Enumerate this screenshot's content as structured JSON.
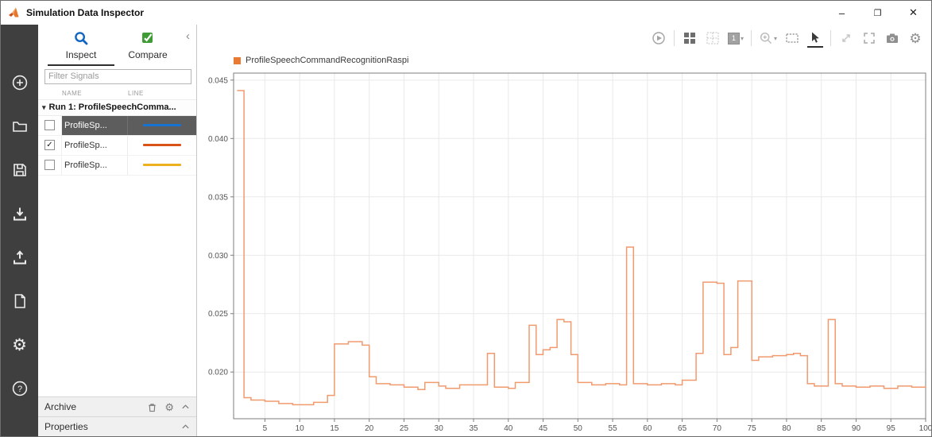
{
  "window": {
    "title": "Simulation Data Inspector",
    "controls": {
      "minimize": "–",
      "maximize": "❐",
      "close": "✕"
    }
  },
  "icons": {
    "checkmark": "✓",
    "caret_down": "▾",
    "collapse_sidebar": "‹",
    "gear": "⚙",
    "help": "?"
  },
  "left_rail": {
    "icons": [
      "add-icon",
      "open-folder-icon",
      "save-icon",
      "import-icon",
      "export-icon",
      "new-report-icon",
      "preferences-gear-icon",
      "help-icon"
    ]
  },
  "sidebar": {
    "tabs": [
      {
        "label": "Inspect",
        "active": true
      },
      {
        "label": "Compare",
        "active": false
      }
    ],
    "filter_placeholder": "Filter Signals",
    "columns": {
      "name": "NAME",
      "line": "LINE"
    },
    "run_group": "Run 1: ProfileSpeechComma...",
    "signals": [
      {
        "label": "ProfileSp...",
        "checked": false,
        "selected": true,
        "color": "#1673d2"
      },
      {
        "label": "ProfileSp...",
        "checked": true,
        "selected": false,
        "color": "#d95319"
      },
      {
        "label": "ProfileSp...",
        "checked": false,
        "selected": false,
        "color": "#edb120"
      }
    ],
    "archive_label": "Archive",
    "properties_label": "Properties"
  },
  "chart_toolbar": {
    "layout_value": "1",
    "icons": [
      "playback-icon",
      "layout-grid-icon",
      "subplot-grid-icon",
      "layout-dropdown",
      "zoom-in-icon",
      "zoom-region-icon",
      "pointer-icon",
      "expand-diagonal-icon",
      "fit-to-view-icon",
      "snapshot-camera-icon",
      "settings-gear-icon"
    ]
  },
  "chart": {
    "legend": "ProfileSpeechCommandRecognitionRaspi",
    "legend_color": "#e87a33"
  },
  "chart_data": {
    "type": "line",
    "step": true,
    "title": "",
    "xlabel": "",
    "ylabel": "",
    "grid": true,
    "xlim": [
      0.5,
      100
    ],
    "ylim": [
      0.016,
      0.0456
    ],
    "xticks": [
      5,
      10,
      15,
      20,
      25,
      30,
      35,
      40,
      45,
      50,
      55,
      60,
      65,
      70,
      75,
      80,
      85,
      90,
      95,
      100
    ],
    "yticks": [
      0.02,
      0.025,
      0.03,
      0.035,
      0.04,
      0.045
    ],
    "series": [
      {
        "name": "ProfileSpeechCommandRecognitionRaspi",
        "color": "#f09a6e",
        "x": [
          1,
          2,
          3,
          5,
          7,
          9,
          12,
          14,
          15,
          17,
          19,
          20,
          21,
          23,
          25,
          27,
          28,
          30,
          31,
          33,
          35,
          37,
          38,
          40,
          41,
          43,
          44,
          45,
          46,
          47,
          48,
          49,
          50,
          52,
          54,
          56,
          57,
          58,
          60,
          62,
          64,
          65,
          67,
          68,
          70,
          71,
          72,
          73,
          75,
          76,
          78,
          80,
          81,
          82,
          83,
          84,
          86,
          87,
          88,
          90,
          92,
          94,
          96,
          98,
          100
        ],
        "y": [
          0.0441,
          0.0178,
          0.0176,
          0.0175,
          0.0173,
          0.0172,
          0.0174,
          0.018,
          0.0224,
          0.0226,
          0.0223,
          0.0196,
          0.019,
          0.0189,
          0.0187,
          0.0185,
          0.0191,
          0.0188,
          0.0186,
          0.0189,
          0.0189,
          0.0216,
          0.0187,
          0.0186,
          0.0191,
          0.024,
          0.0215,
          0.0219,
          0.0221,
          0.0245,
          0.0243,
          0.0215,
          0.0191,
          0.0189,
          0.019,
          0.0189,
          0.0307,
          0.019,
          0.0189,
          0.019,
          0.0189,
          0.0193,
          0.0216,
          0.0277,
          0.0276,
          0.0215,
          0.0221,
          0.0278,
          0.021,
          0.0213,
          0.0214,
          0.0215,
          0.0216,
          0.0214,
          0.019,
          0.0188,
          0.0245,
          0.019,
          0.0188,
          0.0187,
          0.0188,
          0.0186,
          0.0188,
          0.0187,
          0.0188
        ]
      }
    ]
  }
}
